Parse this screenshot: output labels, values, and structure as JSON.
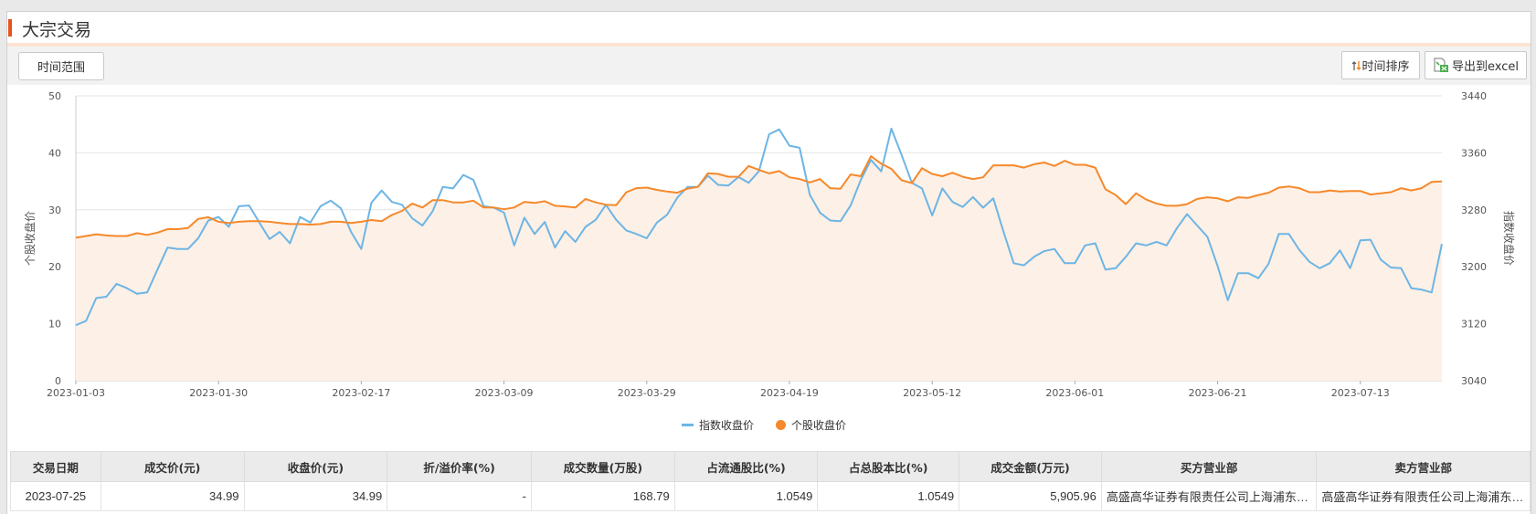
{
  "header": {
    "title": "大宗交易"
  },
  "toolbar": {
    "range_label": "时间范围",
    "sort_label": "时间排序",
    "export_label": "导出到excel"
  },
  "colors": {
    "accent": "#e8531c",
    "index_line": "#6db5e5",
    "stock_line": "#f5892b",
    "stock_fill": "#fdf0e6"
  },
  "chart_data": {
    "type": "line",
    "title": "",
    "ylabel_left": "个股收盘价",
    "ylabel_right": "指数收盘价",
    "ylim_left": [
      0,
      50
    ],
    "ylim_right": [
      3040,
      3440
    ],
    "yticks_left": [
      "0",
      "10",
      "20",
      "30",
      "40",
      "50"
    ],
    "yticks_right": [
      "3040",
      "3120",
      "3200",
      "3280",
      "3360",
      "3440"
    ],
    "xtick_labels": [
      "2023-01-03",
      "2023-01-30",
      "2023-02-17",
      "2023-03-09",
      "2023-03-29",
      "2023-04-19",
      "2023-05-12",
      "2023-06-01",
      "2023-06-21",
      "2023-07-13"
    ],
    "xtick_step": 14,
    "grid": true,
    "legend_position": "bottom",
    "series": [
      {
        "name": "指数收盘价",
        "axis": "right",
        "color": "#6db5e5",
        "values": [
          3118,
          3124,
          3156,
          3158,
          3176,
          3170,
          3162,
          3164,
          3196,
          3227,
          3225,
          3225,
          3240,
          3265,
          3270,
          3256,
          3285,
          3286,
          3262,
          3239,
          3249,
          3233,
          3270,
          3262,
          3285,
          3293,
          3282,
          3249,
          3225,
          3290,
          3307,
          3291,
          3287,
          3268,
          3258,
          3278,
          3312,
          3310,
          3329,
          3322,
          3285,
          3283,
          3276,
          3230,
          3269,
          3246,
          3263,
          3227,
          3250,
          3235,
          3256,
          3266,
          3287,
          3266,
          3251,
          3246,
          3240,
          3262,
          3273,
          3297,
          3312,
          3312,
          3328,
          3315,
          3314,
          3326,
          3318,
          3334,
          3386,
          3393,
          3370,
          3367,
          3301,
          3276,
          3265,
          3264,
          3286,
          3322,
          3350,
          3334,
          3394,
          3357,
          3318,
          3310,
          3272,
          3310,
          3291,
          3284,
          3298,
          3283,
          3296,
          3249,
          3205,
          3202,
          3214,
          3222,
          3225,
          3205,
          3205,
          3230,
          3233,
          3196,
          3198,
          3214,
          3233,
          3230,
          3235,
          3230,
          3254,
          3274,
          3258,
          3242,
          3201,
          3153,
          3191,
          3191,
          3184,
          3204,
          3246,
          3246,
          3224,
          3207,
          3198,
          3205,
          3223,
          3198,
          3237,
          3238,
          3210,
          3199,
          3198,
          3170,
          3168,
          3164,
          3232
        ]
      },
      {
        "name": "个股收盘价",
        "axis": "left",
        "color": "#f5892b",
        "values": [
          25.1,
          25.4,
          25.7,
          25.5,
          25.4,
          25.4,
          25.9,
          25.6,
          26.0,
          26.6,
          26.6,
          26.8,
          28.4,
          28.7,
          27.9,
          27.7,
          27.9,
          28.0,
          28.0,
          27.9,
          27.7,
          27.5,
          27.5,
          27.4,
          27.5,
          27.9,
          27.9,
          27.7,
          27.9,
          28.2,
          28.0,
          29.1,
          29.8,
          31.1,
          30.4,
          31.7,
          31.7,
          31.3,
          31.3,
          31.6,
          30.4,
          30.4,
          30.1,
          30.4,
          31.4,
          31.2,
          31.5,
          30.7,
          30.6,
          30.4,
          31.9,
          31.3,
          30.9,
          30.8,
          33.1,
          33.8,
          33.9,
          33.5,
          33.2,
          33.0,
          33.7,
          34.0,
          36.4,
          36.3,
          35.8,
          35.8,
          37.7,
          37.0,
          36.4,
          36.8,
          35.7,
          35.4,
          34.8,
          35.4,
          33.8,
          33.7,
          36.2,
          35.9,
          39.4,
          38.1,
          37.2,
          35.2,
          34.7,
          37.3,
          36.3,
          35.9,
          36.5,
          35.8,
          35.4,
          35.7,
          37.8,
          37.8,
          37.8,
          37.4,
          38.0,
          38.3,
          37.7,
          38.6,
          37.9,
          37.9,
          37.4,
          33.6,
          32.6,
          31.0,
          32.9,
          31.8,
          31.1,
          30.7,
          30.7,
          31.0,
          31.9,
          32.2,
          32.0,
          31.5,
          32.2,
          32.1,
          32.6,
          33.0,
          33.9,
          34.1,
          33.8,
          33.1,
          33.1,
          33.4,
          33.2,
          33.3,
          33.3,
          32.7,
          32.9,
          33.1,
          33.8,
          33.4,
          33.8,
          34.9,
          34.99
        ]
      }
    ]
  },
  "table": {
    "headers": [
      "交易日期",
      "成交价(元)",
      "收盘价(元)",
      "折/溢价率(%)",
      "成交数量(万股)",
      "占流通股比(%)",
      "占总股本比(%)",
      "成交金额(万元)",
      "买方营业部",
      "卖方营业部"
    ],
    "rows": [
      [
        "2023-07-25",
        "34.99",
        "34.99",
        "-",
        "168.79",
        "1.0549",
        "1.0549",
        "5,905.96",
        "高盛高华证券有限责任公司上海浦东新区世纪大道证券营业部",
        "高盛高华证券有限责任公司上海浦东新区世纪大道证券营业部"
      ]
    ]
  }
}
